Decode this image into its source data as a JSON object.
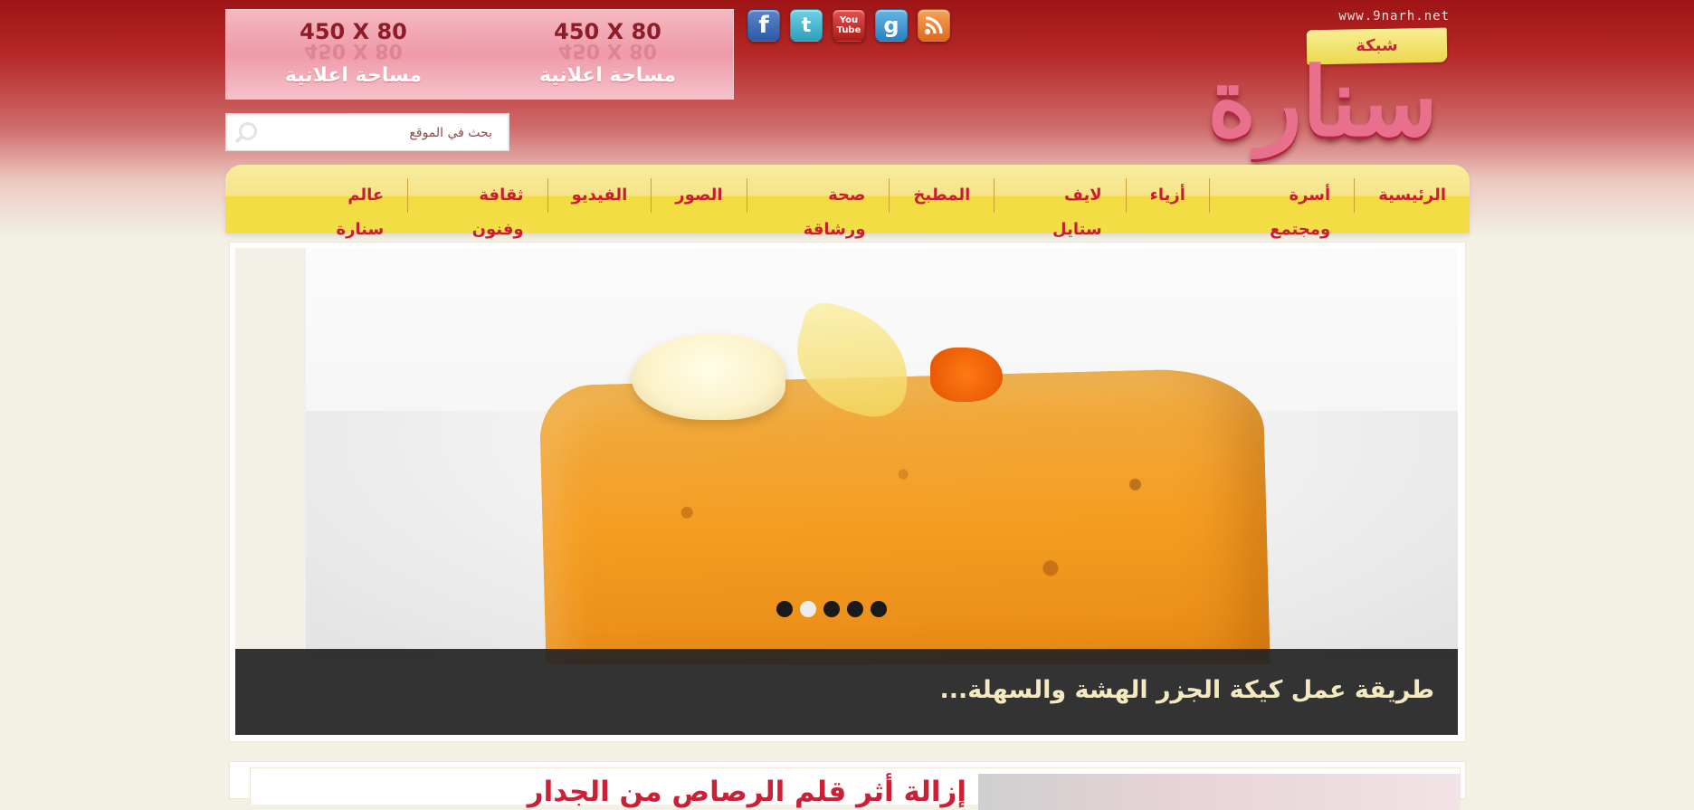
{
  "ad_banner": {
    "slots": [
      {
        "size": "450 X 80",
        "label": "مساحة اعلانية"
      },
      {
        "size": "450 X 80",
        "label": "مساحة اعلانية"
      }
    ]
  },
  "social": [
    {
      "name": "facebook-icon",
      "glyph": "f"
    },
    {
      "name": "twitter-icon",
      "glyph": "t"
    },
    {
      "name": "youtube-icon",
      "glyph_top": "You",
      "glyph_bottom": "Tube"
    },
    {
      "name": "google-icon",
      "glyph": "g"
    },
    {
      "name": "rss-icon",
      "glyph": "◉"
    }
  ],
  "search": {
    "placeholder": "بحث في الموقع"
  },
  "logo": {
    "url": "www.9narh.net",
    "tag": "شبكة",
    "mark": "سنارة"
  },
  "nav": {
    "items": [
      "الرئيسية",
      "أسرة ومجتمع",
      "أزياء",
      "لايف ستايل",
      "المطبخ",
      "صحة ورشاقة",
      "الصور",
      "الفيديو",
      "ثقافة وفنون",
      "عالم سنارة"
    ]
  },
  "slider": {
    "caption": "طريقة عمل كيكة الجزر الهشة والسهلة...",
    "dot_count": 5,
    "active_dot": 2
  },
  "article": {
    "title": "إزالة أثر قلم الرصاص من الجدار"
  },
  "colors": {
    "brand_red": "#c91d35",
    "nav_yellow": "#f2dc3f",
    "caption_bg": "#252525"
  }
}
